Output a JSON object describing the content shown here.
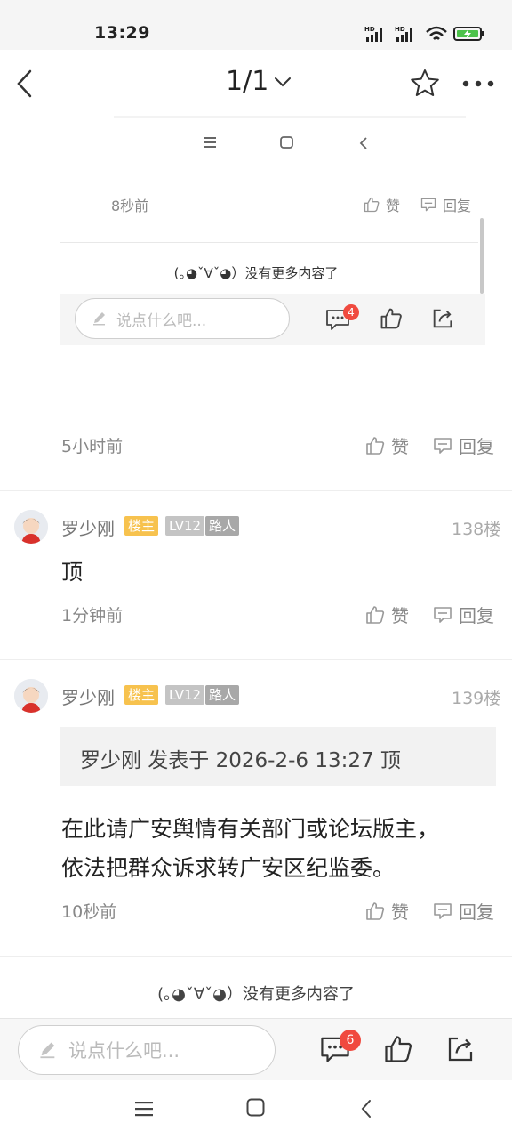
{
  "status_bar": {
    "time": "13:29",
    "icons": [
      "hd-signal-icon",
      "hd-signal-icon",
      "wifi-icon",
      "battery-charging-icon"
    ]
  },
  "nav": {
    "page_indicator": "1/1",
    "back_icon": "chevron-left-icon",
    "star_icon": "star-icon",
    "more_icon": "more-dots-icon"
  },
  "embedded": {
    "time": "8秒前",
    "like_label": "赞",
    "reply_label": "回复",
    "end_text": "(｡◕ˇ∀ˇ◕）没有更多内容了",
    "input_placeholder": "说点什么吧...",
    "comment_badge": "4"
  },
  "prev_comment": {
    "time": "5小时前",
    "like_label": "赞",
    "reply_label": "回复"
  },
  "comments": [
    {
      "author": "罗少刚",
      "tag_owner": "楼主",
      "tag_level": "LV12",
      "tag_role": "路人",
      "floor": "138楼",
      "text": "顶",
      "time": "1分钟前",
      "like_label": "赞",
      "reply_label": "回复"
    },
    {
      "author": "罗少刚",
      "tag_owner": "楼主",
      "tag_level": "LV12",
      "tag_role": "路人",
      "floor": "139楼",
      "quote": "罗少刚 发表于 2026-2-6 13:27 顶",
      "text_line1": "在此请广安舆情有关部门或论坛版主，",
      "text_line2": "依法把群众诉求转广安区纪监委。",
      "time": "10秒前",
      "like_label": "赞",
      "reply_label": "回复"
    }
  ],
  "end_text": "(｡◕ˇ∀ˇ◕）没有更多内容了",
  "bottom_bar": {
    "input_placeholder": "说点什么吧...",
    "comment_badge": "6"
  }
}
